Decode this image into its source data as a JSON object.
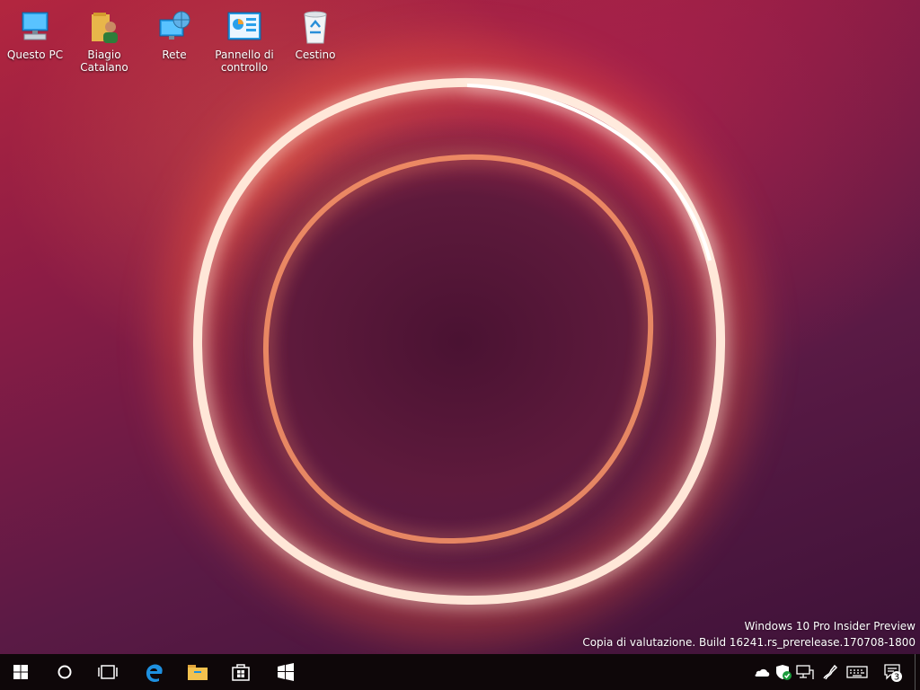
{
  "desktop": {
    "icons": [
      {
        "label": "Questo PC",
        "icon": "computer-icon"
      },
      {
        "label": "Biagio Catalano",
        "icon": "user-folder-icon"
      },
      {
        "label": "Rete",
        "icon": "network-icon"
      },
      {
        "label": "Pannello di controllo",
        "icon": "control-panel-icon"
      },
      {
        "label": "Cestino",
        "icon": "recycle-bin-icon"
      }
    ]
  },
  "watermark": {
    "line1": "Windows 10 Pro Insider Preview",
    "line2": "Copia di valutazione. Build 16241.rs_prerelease.170708-1800"
  },
  "taskbar": {
    "buttons": [
      "start-icon",
      "cortana-icon",
      "task-view-icon",
      "edge-icon",
      "file-explorer-icon",
      "store-icon",
      "app-icon"
    ],
    "tray": {
      "icons": [
        "onedrive-icon",
        "defender-icon",
        "network-icon",
        "pen-icon",
        "keyboard-icon"
      ],
      "notification_count": "3"
    }
  },
  "colors": {
    "taskbar": "#0e0709",
    "accent_blue": "#1e90e0"
  }
}
